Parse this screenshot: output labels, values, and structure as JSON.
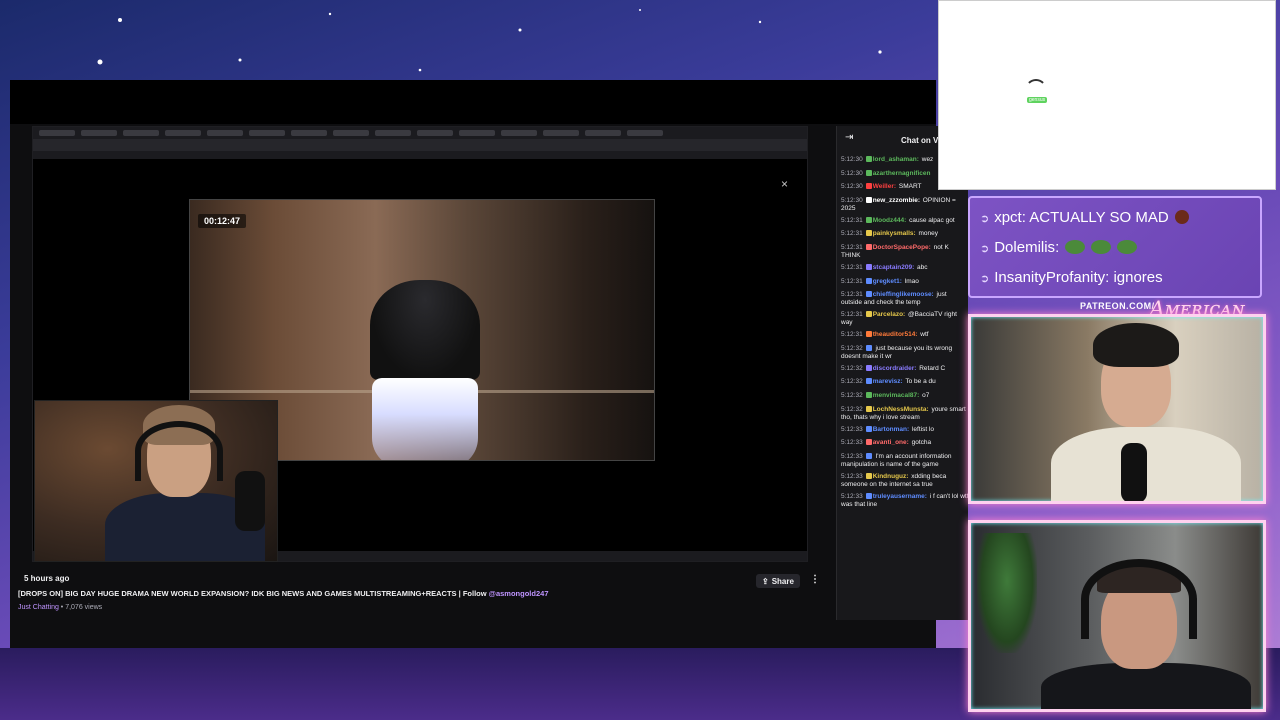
{
  "video": {
    "timer": "00:12:47",
    "time_ago": "5 hours ago",
    "title": "[DROPS ON] BIG DAY HUGE DRAMA NEW WORLD EXPANSION? IDK BIG NEWS AND GAMES MULTISTREAMING+REACTS | Follow ",
    "follow_handle": "@asmongold247",
    "category": "Just Chatting",
    "views": " • 7,076 views",
    "share_label": "Share",
    "more_label": "⋮",
    "close_label": "×"
  },
  "chat": {
    "title": "Chat on Vi",
    "collapse_icon": "⇥",
    "messages": [
      {
        "ts": "5:12:30",
        "user": "lord_ashaman:",
        "text": " wez",
        "color": "#5cb85c"
      },
      {
        "ts": "5:12:30",
        "user": "azarthernagnificen",
        "text": "",
        "color": "#5cb85c"
      },
      {
        "ts": "5:12:30",
        "user": "Weiller:",
        "text": " SMART",
        "color": "#ff4040"
      },
      {
        "ts": "5:12:30",
        "user": "new_zzzombie:",
        "text": " OPINION = 2025",
        "color": "#ffffff"
      },
      {
        "ts": "5:12:31",
        "user": "Moodz444:",
        "text": " cause alpac got",
        "color": "#5cb85c"
      },
      {
        "ts": "5:12:31",
        "user": "painkysmalls:",
        "text": " money",
        "color": "#e6c84b"
      },
      {
        "ts": "5:12:31",
        "user": "DoctorSpacePope:",
        "text": " not K THINK",
        "color": "#ff6a6a"
      },
      {
        "ts": "5:12:31",
        "user": "stcaptain209:",
        "text": " abc",
        "color": "#8a7bff"
      },
      {
        "ts": "5:12:31",
        "user": "gregket1:",
        "text": " lmao",
        "color": "#5e8cff"
      },
      {
        "ts": "5:12:31",
        "user": "chieffinglikemoose:",
        "text": " just outside and check the temp",
        "color": "#5e8cff"
      },
      {
        "ts": "5:12:31",
        "user": "Parcelazo:",
        "text": " @BacciaTV right way",
        "color": "#e6c84b"
      },
      {
        "ts": "5:12:31",
        "user": "theauditor514:",
        "text": " wtf",
        "color": "#ff7a3a"
      },
      {
        "ts": "5:12:32",
        "user": "",
        "text": " just because you its wrong doesnt make it wr",
        "color": "#5e8cff"
      },
      {
        "ts": "5:12:32",
        "user": "discordraider:",
        "text": " Retard C",
        "color": "#8a7bff"
      },
      {
        "ts": "5:12:32",
        "user": "marevisz:",
        "text": " To be a du",
        "color": "#5e8cff"
      },
      {
        "ts": "5:12:32",
        "user": "menvimacal87:",
        "text": " o7",
        "color": "#5cb85c"
      },
      {
        "ts": "5:12:32",
        "user": "LochNessMunsta:",
        "text": " youre smart tho, thats why i love stream",
        "color": "#e6c84b"
      },
      {
        "ts": "5:12:33",
        "user": "Bartonman:",
        "text": " leftist lo",
        "color": "#5e8cff"
      },
      {
        "ts": "5:12:33",
        "user": "avanti_one:",
        "text": " gotcha",
        "color": "#ff6a6a"
      },
      {
        "ts": "5:12:33",
        "user": "",
        "text": " I'm an account information manipulation is name of the game",
        "color": "#5e8cff"
      },
      {
        "ts": "5:12:33",
        "user": "Kindnuguz:",
        "text": " xdding beca someone on the internet sa true",
        "color": "#e6c84b"
      },
      {
        "ts": "5:12:33",
        "user": "truleyausername:",
        "text": " i f can't lol wtf was that line",
        "color": "#5e8cff"
      }
    ]
  },
  "overlay_chat": {
    "lines": [
      {
        "name": "xpct",
        "text": ": ACTUALLY SO MAD",
        "emote": "brown"
      },
      {
        "name": "Dolemilis",
        "text": ":",
        "emote": "pepe"
      },
      {
        "name": "InsanityProfanity",
        "text": ": ignores",
        "emote": ""
      }
    ]
  },
  "overlay": {
    "patreon": "PATREON.COM/",
    "script_logo": "Aᴍᴇʀɪᴄᴀɴ",
    "gensus_tag": "gensus"
  },
  "colors": {
    "accent": "#bf94ff",
    "overlay_purple": "#7d53c4",
    "frame_pink": "#ffd1ef"
  }
}
